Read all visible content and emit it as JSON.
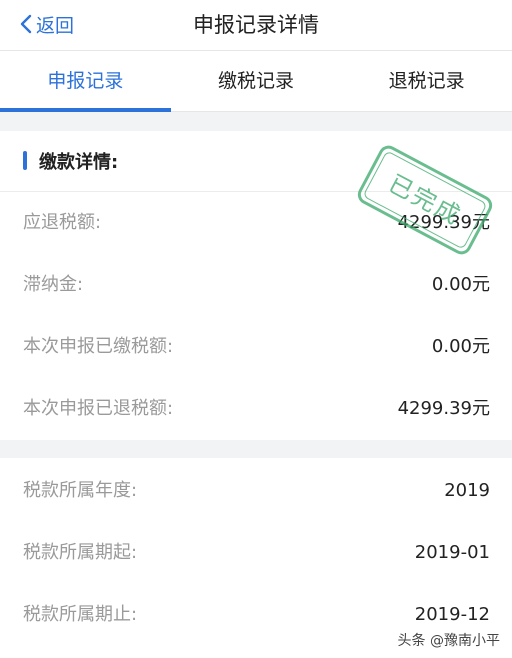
{
  "header": {
    "back_label": "返回",
    "title": "申报记录详情"
  },
  "tabs": [
    {
      "label": "申报记录",
      "active": true
    },
    {
      "label": "缴税记录",
      "active": false
    },
    {
      "label": "退税记录",
      "active": false
    }
  ],
  "payment": {
    "section_title": "缴款详情:",
    "rows": [
      {
        "label": "应退税额:",
        "value": "4299.39元"
      },
      {
        "label": "滞纳金:",
        "value": "0.00元"
      },
      {
        "label": "本次申报已缴税额:",
        "value": "0.00元"
      },
      {
        "label": "本次申报已退税额:",
        "value": "4299.39元"
      }
    ],
    "stamp_text": "已完成"
  },
  "period": {
    "rows": [
      {
        "label": "税款所属年度:",
        "value": "2019"
      },
      {
        "label": "税款所属期起:",
        "value": "2019-01"
      },
      {
        "label": "税款所属期止:",
        "value": "2019-12"
      }
    ]
  },
  "watermark": "头条 @豫南小平",
  "colors": {
    "accent": "#2d72d9",
    "stamp": "#39a86a",
    "label": "#9a9a9a",
    "gap": "#f2f3f5"
  }
}
